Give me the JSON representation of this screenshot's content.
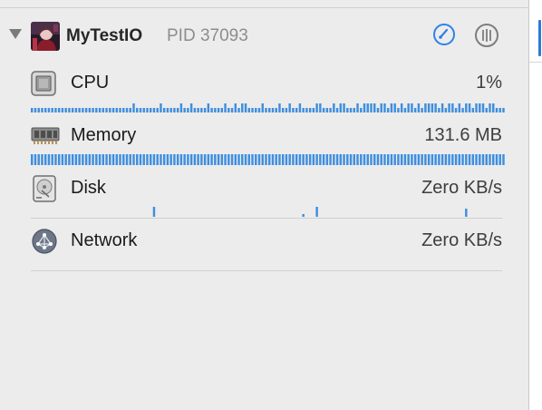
{
  "process": {
    "name": "MyTestIO",
    "pid_label": "PID 37093"
  },
  "gauges": {
    "cpu": {
      "label": "CPU",
      "value": "1%",
      "icon": "cpu-chip-icon"
    },
    "memory": {
      "label": "Memory",
      "value": "131.6 MB",
      "icon": "memory-module-icon"
    },
    "disk": {
      "label": "Disk",
      "value": "Zero KB/s",
      "icon": "hard-disk-icon"
    },
    "network": {
      "label": "Network",
      "value": "Zero KB/s",
      "icon": "network-globe-icon"
    }
  },
  "colors": {
    "accent": "#2f80e8",
    "graph_bar": "#3f8ede"
  }
}
